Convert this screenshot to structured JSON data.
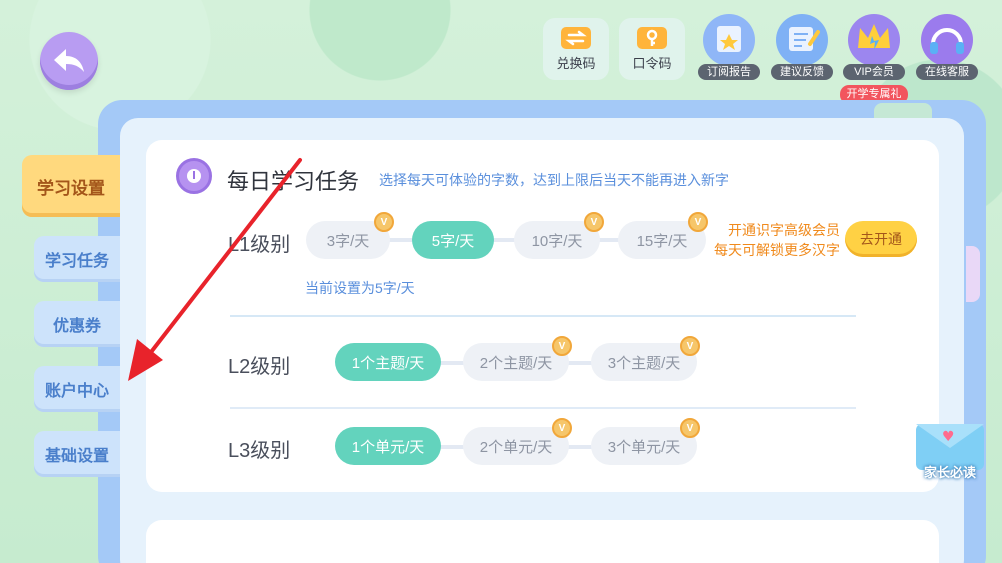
{
  "toolbar": {
    "redeem_code": "兑换码",
    "password_code": "口令码",
    "subscribe_report": "订阅报告",
    "feedback": "建议反馈",
    "vip": "VIP会员",
    "online_service": "在线客服",
    "promo_badge": "开学专属礼"
  },
  "sidebar": {
    "items": [
      {
        "label": "学习设置",
        "active": true
      },
      {
        "label": "学习任务",
        "active": false
      },
      {
        "label": "优惠券",
        "active": false
      },
      {
        "label": "账户中心",
        "active": false
      },
      {
        "label": "基础设置",
        "active": false
      }
    ]
  },
  "daily_task": {
    "title": "每日学习任务",
    "description": "选择每天可体验的字数，达到上限后当天不能再进入新字",
    "current_setting": "当前设置为5字/天",
    "upsell_line1": "开通识字高级会员",
    "upsell_line2": "每天可解锁更多汉字",
    "upsell_button": "去开通",
    "levels": [
      {
        "label": "L1级别",
        "options": [
          "3字/天",
          "5字/天",
          "10字/天",
          "15字/天"
        ],
        "selected": "5字/天"
      },
      {
        "label": "L2级别",
        "options": [
          "1个主题/天",
          "2个主题/天",
          "3个主题/天"
        ],
        "selected": "1个主题/天"
      },
      {
        "label": "L3级别",
        "options": [
          "1个单元/天",
          "2个单元/天",
          "3个单元/天"
        ],
        "selected": "1个单元/天"
      }
    ],
    "badge_letter": "V"
  },
  "parent_read": "家长必读",
  "colors": {
    "selected_pill": "#63d3bd",
    "active_sidebar": "#ffd97e",
    "annotation_arrow": "#e8232b"
  }
}
